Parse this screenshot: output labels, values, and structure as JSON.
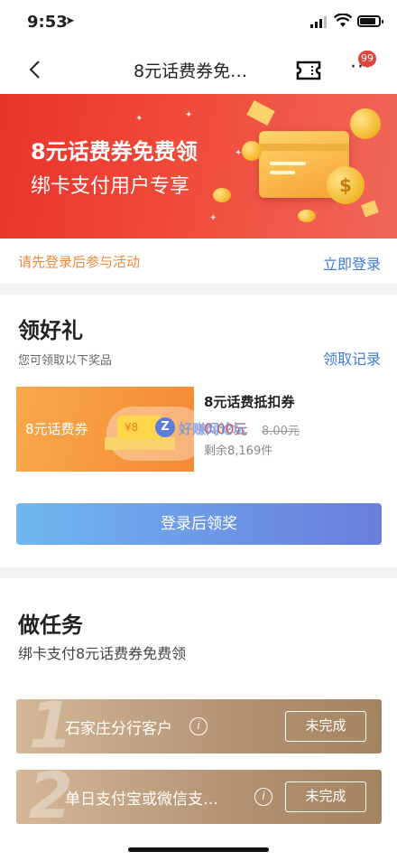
{
  "status_bar": {
    "time": "9:53",
    "location_icon": "location-arrow-icon"
  },
  "nav": {
    "title": "8元话费券免…",
    "back_icon": "chevron-left-icon",
    "ticket_icon": "ticket-icon",
    "more_label": "···",
    "badge": "99"
  },
  "banner": {
    "headline": "8元话费券免费领",
    "subline": "绑卡支付用户专享",
    "coin_symbol": "$"
  },
  "login_bar": {
    "notice": "请先登录后参与活动",
    "login_link": "立即登录"
  },
  "gift": {
    "title": "领好礼",
    "subtitle": "您可领取以下奖品",
    "record_link": "领取记录",
    "prize": {
      "image_label": "8元话费券",
      "bill_label": "¥8",
      "name": "8元话费抵扣券",
      "price": "0.00元",
      "original_price": "8.00元",
      "remaining": "剩余8,169件"
    },
    "watermark": "好赚网论坛",
    "watermark_logo": "Z",
    "claim_button": "登录后领奖"
  },
  "task": {
    "title": "做任务",
    "subtitle": "绑卡支付8元话费券免费领",
    "items": [
      {
        "number": "1",
        "name": "石家庄分行客户",
        "info": "i",
        "state": "未完成"
      },
      {
        "number": "2",
        "name": "单日支付宝或微信支…",
        "info": "i",
        "state": "未完成"
      }
    ]
  },
  "colors": {
    "banner_red": "#e9332d",
    "accent_orange": "#f08a3b",
    "link_blue": "#3e7bd6",
    "task_gold": "#b39272"
  }
}
